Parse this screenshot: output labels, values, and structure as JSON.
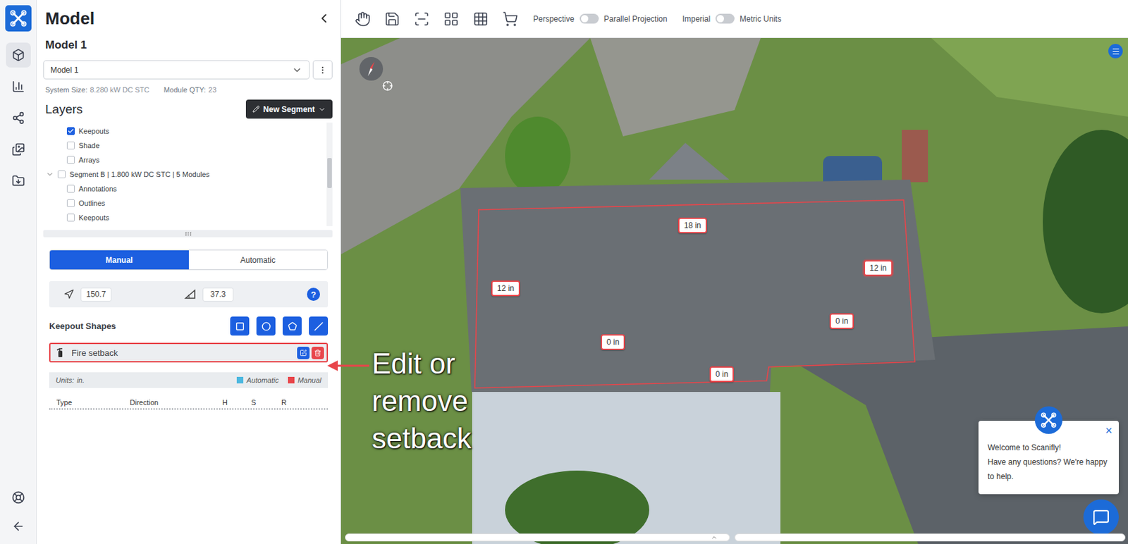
{
  "rail": {
    "items": [
      {
        "kind": "model",
        "selected": true
      },
      {
        "kind": "analytics",
        "selected": false
      },
      {
        "kind": "share",
        "selected": false
      },
      {
        "kind": "images",
        "selected": false
      },
      {
        "kind": "export",
        "selected": false
      }
    ],
    "bottom": [
      {
        "kind": "help"
      },
      {
        "kind": "back"
      }
    ]
  },
  "panel": {
    "title": "Model",
    "model_name": "Model 1",
    "model_select": "Model 1",
    "stats": [
      {
        "label": "System Size:",
        "value": "8.280 kW DC STC"
      },
      {
        "label": "Module QTY:",
        "value": "23"
      }
    ]
  },
  "layers": {
    "title": "Layers",
    "new_button": "New Segment",
    "rows": [
      {
        "label": "Keepouts",
        "kind": "child",
        "checked": true
      },
      {
        "label": "Shade",
        "kind": "child",
        "checked": false
      },
      {
        "label": "Arrays",
        "kind": "child",
        "checked": false
      },
      {
        "label": "Segment B | 1.800 kW DC STC | 5 Modules",
        "kind": "segment",
        "checked": false,
        "expanded": true
      },
      {
        "label": "Annotations",
        "kind": "child",
        "checked": false
      },
      {
        "label": "Outlines",
        "kind": "child",
        "checked": false
      },
      {
        "label": "Keepouts",
        "kind": "child",
        "checked": false
      }
    ]
  },
  "mode_tabs": [
    {
      "label": "Manual",
      "selected": true
    },
    {
      "label": "Automatic",
      "selected": false
    }
  ],
  "orientation": {
    "azimuth": "150.7",
    "pitch": "37.3",
    "help": "?"
  },
  "keepouts": {
    "title": "Keepout Shapes",
    "shapes": [
      {
        "kind": "square"
      },
      {
        "kind": "circle"
      },
      {
        "kind": "polygon"
      },
      {
        "kind": "line"
      }
    ],
    "items": [
      {
        "label": "Fire setback",
        "selected": true
      }
    ]
  },
  "units": {
    "label": "Units:",
    "value": "in.",
    "legend": [
      {
        "label": "Automatic",
        "color": "#4cb8e0"
      },
      {
        "label": "Manual",
        "color": "#e8454a"
      }
    ]
  },
  "table": {
    "columns": [
      "Type",
      "Direction",
      "H",
      "S",
      "R"
    ]
  },
  "toolbar": {
    "tools": [
      {
        "kind": "pan"
      },
      {
        "kind": "save"
      },
      {
        "kind": "scan"
      },
      {
        "kind": "layout"
      },
      {
        "kind": "grid"
      },
      {
        "kind": "roof"
      }
    ],
    "toggles": [
      {
        "left": "Perspective",
        "right": "Parallel Projection",
        "on": false
      },
      {
        "left": "Imperial",
        "right": "Metric Units",
        "on": false
      }
    ]
  },
  "viewport": {
    "setbacks": [
      {
        "text": "18 in",
        "editing": false
      },
      {
        "text": "12 in",
        "editing": false
      },
      {
        "text": "12 in",
        "editing": true
      },
      {
        "text": "0 in",
        "editing": false
      },
      {
        "text": "0 in",
        "editing": false
      },
      {
        "text": "0 in",
        "editing": false
      }
    ]
  },
  "callout": {
    "text": "Edit or remove setback"
  },
  "chat": {
    "title": "Welcome to Scanifly!",
    "message": "Have any questions? We're happy to help.",
    "close": "×"
  }
}
